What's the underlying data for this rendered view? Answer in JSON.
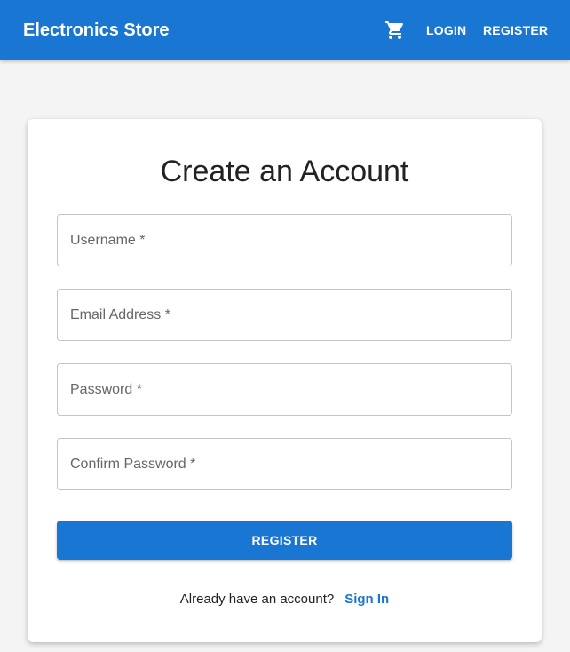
{
  "header": {
    "brand": "Electronics Store",
    "cart_icon": "shopping-cart-icon",
    "login_label": "LOGIN",
    "register_label": "REGISTER"
  },
  "form": {
    "title": "Create an Account",
    "fields": [
      {
        "placeholder": "Username *",
        "value": ""
      },
      {
        "placeholder": "Email Address *",
        "value": ""
      },
      {
        "placeholder": "Password *",
        "value": ""
      },
      {
        "placeholder": "Confirm Password *",
        "value": ""
      }
    ],
    "submit_label": "REGISTER",
    "footer_text": "Already have an account?",
    "signin_label": "Sign In"
  },
  "colors": {
    "primary": "#1976d2",
    "background": "#f4f4f4",
    "card": "#ffffff",
    "border": "#c4c4c4"
  }
}
